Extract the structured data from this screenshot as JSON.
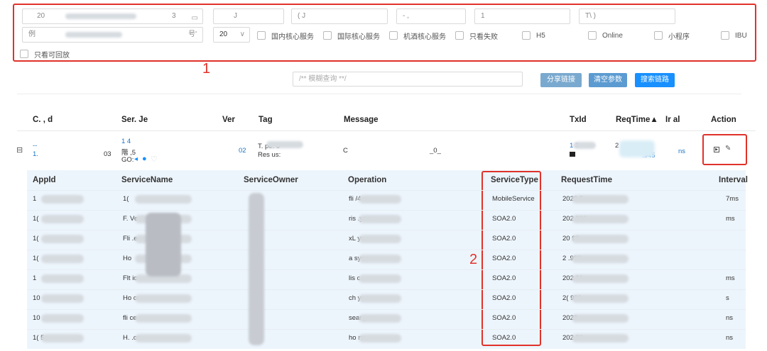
{
  "filters": {
    "date_range": {
      "start": "20",
      "end": "3"
    },
    "field2": "J",
    "field3": "( J",
    "field4": "- ,",
    "field5": "1",
    "field6": "T\\ )",
    "example_field": {
      "value": "例",
      "suffix": "号'"
    },
    "page_size": "20",
    "checkboxes": [
      "国内核心服务",
      "国际核心服务",
      "机酒核心服务",
      "只看失败",
      "H5",
      "Online",
      "小程序",
      "IBU"
    ],
    "playback_checkbox": "只看可回放"
  },
  "annotations": {
    "box1": "1",
    "box2": "2"
  },
  "query": {
    "placeholder": "/** 模糊查询 **/"
  },
  "buttons": {
    "share": "分享链接",
    "clear": "清空参数",
    "search": "搜索链路"
  },
  "colors": {
    "share": "#7aa9cf",
    "clear": "#5b9bd1",
    "search": "#1890ff",
    "annot": "#e0322b"
  },
  "main_table": {
    "headers": [
      "C. , d",
      "Ser. Je",
      "Ver",
      "Tag",
      "Message",
      "TxId",
      "ReqTime▲",
      "Ir al",
      "Action"
    ],
    "row": {
      "expand": "⊟",
      "appid": [
        "--",
        "1."
      ],
      "appid_tail": "03",
      "service": [
        "1 4",
        "階 ,5"
      ],
      "go_label": "GO:",
      "ver": "02",
      "tag": [
        "T. pe: 0",
        "Res us:"
      ],
      "message": "C",
      "message_tail": "_0_",
      "txid": "1 3···",
      "reqtime": [
        "2",
        ".945"
      ],
      "interval": "ns"
    }
  },
  "sub_table": {
    "headers": [
      "AppId",
      "ServiceName",
      "ServiceOwner",
      "Operation",
      "ServiceType",
      "RequestTime",
      "Interval"
    ],
    "rows": [
      {
        "appid": "1",
        "service": "1(",
        "op": "fli /4",
        "type": "MobileService",
        "time": "2022 5",
        "interval": "7ms"
      },
      {
        "appid": "1(",
        "service": "F. Ve. ic",
        "op": "ris .ync",
        "type": "SOA2.0",
        "time": "202 990",
        "interval": "ms"
      },
      {
        "appid": "1(",
        "service": "Fli .e",
        "op": "xL ync",
        "type": "SOA2.0",
        "time": "20 90",
        "interval": ""
      },
      {
        "appid": "1(",
        "service": "Ho",
        "op": "a sync",
        "type": "SOA2.0",
        "time": "2 .990",
        "interval": ""
      },
      {
        "appid": "1",
        "service": "Flt ice",
        "op": "lis c",
        "type": "SOA2.0",
        "time": "202 91",
        "interval": "ms"
      },
      {
        "appid": "10",
        "service": "Ho ce",
        "op": "ch ync",
        "type": "SOA2.0",
        "time": "2( 989",
        "interval": "s"
      },
      {
        "appid": "10",
        "service": "fli ce",
        "op": "sear ync",
        "type": "SOA2.0",
        "time": "2022-",
        "interval": "ns"
      },
      {
        "appid": "1( 5",
        "service": "H. .ce",
        "op": "ho nc",
        "type": "SOA2.0",
        "time": "202 90",
        "interval": "ns"
      }
    ]
  }
}
